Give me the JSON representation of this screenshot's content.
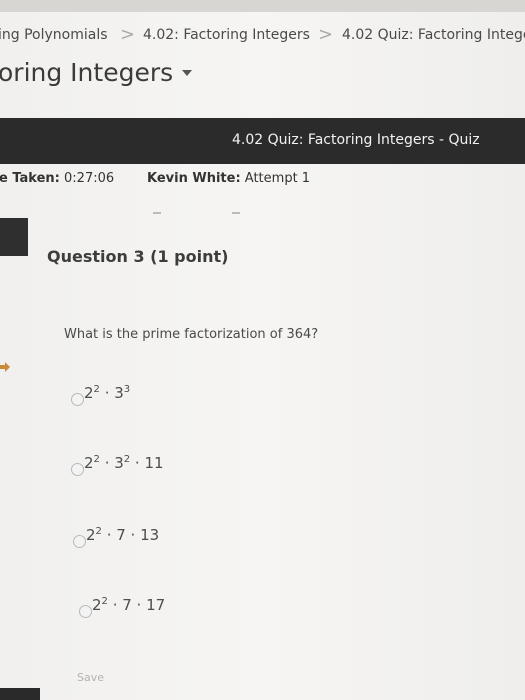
{
  "breadcrumb": {
    "items": [
      "ing Polynomials",
      "4.02: Factoring Integers",
      "4.02 Quiz: Factoring Integer"
    ],
    "separator": ">"
  },
  "page": {
    "title": "oring Integers"
  },
  "quiz_bar": {
    "title": "4.02 Quiz: Factoring Integers - Quiz"
  },
  "info": {
    "time_label": "e Taken:",
    "time_value": "0:27:06",
    "user_label": "Kevin White:",
    "attempt": "Attempt 1"
  },
  "question": {
    "title": "Question 3 (1 point)",
    "prompt": "What is the prime factorization of 364?",
    "options": [
      {
        "parts": [
          {
            "base": "2",
            "exp": "2"
          },
          {
            "base": "3",
            "exp": "3"
          }
        ]
      },
      {
        "parts": [
          {
            "base": "2",
            "exp": "2"
          },
          {
            "base": "3",
            "exp": "2"
          },
          {
            "base": "11",
            "exp": ""
          }
        ]
      },
      {
        "parts": [
          {
            "base": "2",
            "exp": "2"
          },
          {
            "base": "7",
            "exp": ""
          },
          {
            "base": "13",
            "exp": ""
          }
        ]
      },
      {
        "parts": [
          {
            "base": "2",
            "exp": "2"
          },
          {
            "base": "7",
            "exp": ""
          },
          {
            "base": "17",
            "exp": ""
          }
        ]
      }
    ]
  },
  "footer": {
    "save_label": "Save"
  },
  "colors": {
    "quiz_bar": "#2b2b2b",
    "background": "#f3f2f0"
  }
}
